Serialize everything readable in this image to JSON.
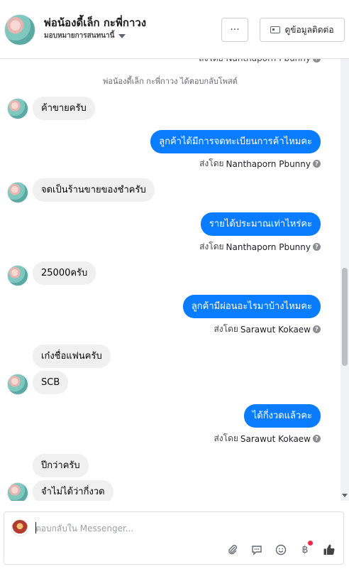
{
  "header": {
    "title": "พ่อน้องดี้เล็ก กะพี่กาวง",
    "subtitle": "มอบหมายการสนทนานี้",
    "more_label": "···",
    "contact_label": "ดูข้อมูลติดต่อ"
  },
  "chat": {
    "top_partial_sent_by": "ส่งโดย Nanthaporn Pbunny",
    "system_message": "พ่อน้องดี้เล็ก กะพี่กาวง ได้ตอบกลับโพสต์",
    "messages": [
      {
        "dir": "in",
        "text": "ค้าขายครับ"
      },
      {
        "dir": "out",
        "text": "ลูกค้าได้มีการจดทะเบียนการค้าไหมคะ",
        "sent_by": "ส่งโดย",
        "sender": "Nanthaporn Pbunny"
      },
      {
        "dir": "in",
        "text": "จดเป็นร้านขายของชำครับ"
      },
      {
        "dir": "out",
        "text": "รายได้ประมาณเท่าไหร่คะ",
        "sent_by": "ส่งโดย",
        "sender": "Nanthaporn Pbunny"
      },
      {
        "dir": "in",
        "text": "25000ครับ"
      },
      {
        "dir": "out",
        "text": "ลูกค้ามีผ่อนอะไรมาบ้างไหมคะ",
        "sent_by": "ส่งโดย",
        "sender": "Sarawut Kokaew"
      },
      {
        "dir": "in",
        "text": "เก๋งชื่อแฟนครับ"
      },
      {
        "dir": "in",
        "text": "SCB"
      },
      {
        "dir": "out",
        "text": "ได้กี่งวดแล้วคะ",
        "sent_by": "ส่งโดย",
        "sender": "Sarawut Kokaew"
      },
      {
        "dir": "in",
        "text": "ปีกว่าครับ"
      },
      {
        "dir": "in",
        "text": "จำไม่ได้ว่ากี่งวด"
      }
    ]
  },
  "composer": {
    "placeholder": "ตอบกลับใน Messenger...",
    "icons": [
      "paperclip-icon",
      "quick-reply-icon",
      "emoji-icon",
      "baht-icon",
      "like-icon"
    ]
  },
  "colors": {
    "outgoing_bubble": "#0a7cff",
    "incoming_bubble": "#f0f0f0",
    "notification_dot": "#f02849"
  }
}
